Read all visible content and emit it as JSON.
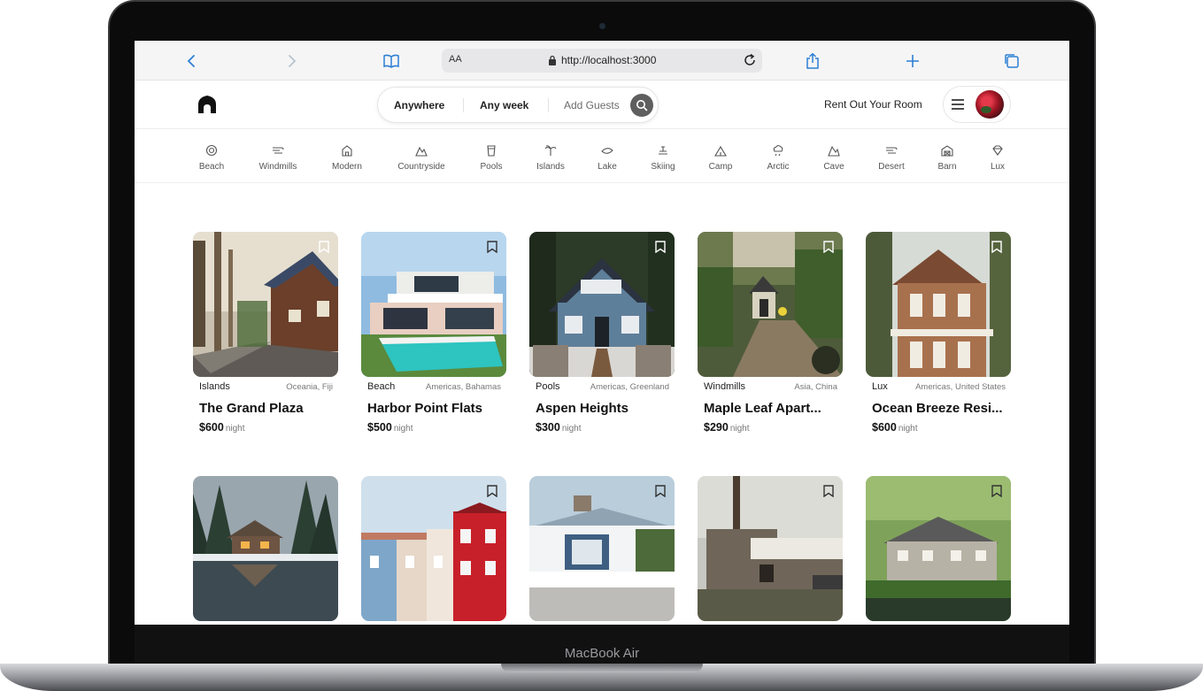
{
  "device": {
    "label": "MacBook Air"
  },
  "browser": {
    "text_size_label": "AA",
    "url": "http://localhost:3000"
  },
  "header": {
    "search": {
      "location": "Anywhere",
      "week": "Any week",
      "guests": "Add Guests"
    },
    "rent_label": "Rent Out Your Room"
  },
  "categories": [
    {
      "label": "Beach",
      "icon": "beach-icon"
    },
    {
      "label": "Windmills",
      "icon": "windmill-icon"
    },
    {
      "label": "Modern",
      "icon": "modern-icon"
    },
    {
      "label": "Countryside",
      "icon": "mountain-icon"
    },
    {
      "label": "Pools",
      "icon": "pool-icon"
    },
    {
      "label": "Islands",
      "icon": "island-icon"
    },
    {
      "label": "Lake",
      "icon": "boat-icon"
    },
    {
      "label": "Skiing",
      "icon": "skiing-icon"
    },
    {
      "label": "Camp",
      "icon": "camp-icon"
    },
    {
      "label": "Arctic",
      "icon": "snow-icon"
    },
    {
      "label": "Cave",
      "icon": "cave-icon"
    },
    {
      "label": "Desert",
      "icon": "desert-icon"
    },
    {
      "label": "Barn",
      "icon": "barn-icon"
    },
    {
      "label": "Lux",
      "icon": "diamond-icon"
    }
  ],
  "per_label": "night",
  "listings": [
    {
      "category": "Islands",
      "location": "Oceania, Fiji",
      "title": "The Grand Plaza",
      "price": "$600"
    },
    {
      "category": "Beach",
      "location": "Americas, Bahamas",
      "title": "Harbor Point Flats",
      "price": "$500"
    },
    {
      "category": "Pools",
      "location": "Americas, Greenland",
      "title": "Aspen Heights",
      "price": "$300"
    },
    {
      "category": "Windmills",
      "location": "Asia, China",
      "title": "Maple Leaf Apart...",
      "price": "$290"
    },
    {
      "category": "Lux",
      "location": "Americas, United States",
      "title": "Ocean Breeze Resi...",
      "price": "$600"
    }
  ],
  "colors": {
    "accent": "#5f5f5f",
    "safari_blue": "#2d7fd3",
    "text": "#222222"
  }
}
